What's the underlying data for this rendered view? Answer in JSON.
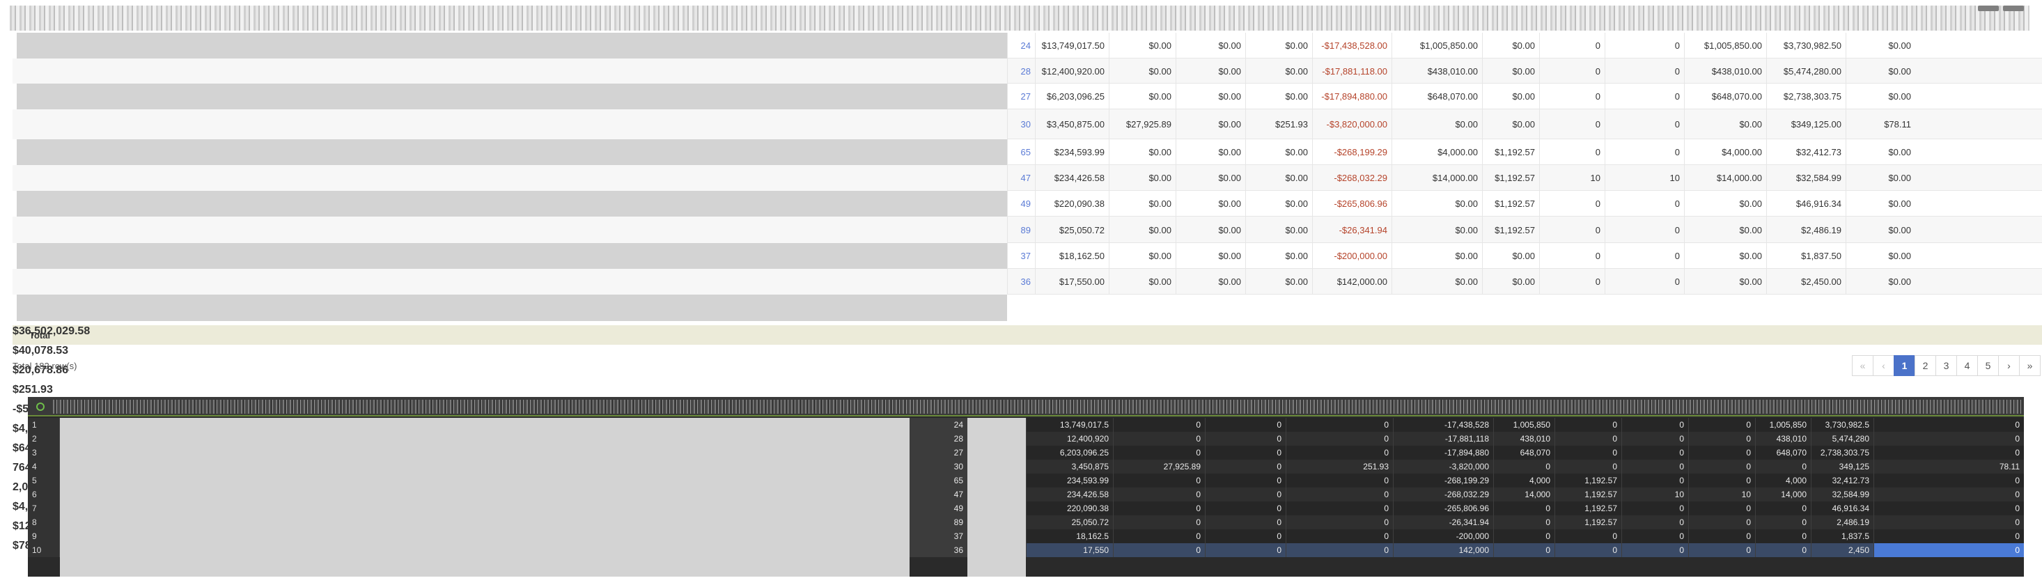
{
  "report": {
    "rows": [
      {
        "id": "24",
        "c1": "$13,749,017.50",
        "c2": "$0.00",
        "c3": "$0.00",
        "c4": "$0.00",
        "c5": "-$17,438,528.00",
        "c6": "$1,005,850.00",
        "c7": "$0.00",
        "c8": "0",
        "c9": "0",
        "c10": "$1,005,850.00",
        "c11": "$3,730,982.50",
        "c12": "$0.00"
      },
      {
        "id": "28",
        "c1": "$12,400,920.00",
        "c2": "$0.00",
        "c3": "$0.00",
        "c4": "$0.00",
        "c5": "-$17,881,118.00",
        "c6": "$438,010.00",
        "c7": "$0.00",
        "c8": "0",
        "c9": "0",
        "c10": "$438,010.00",
        "c11": "$5,474,280.00",
        "c12": "$0.00"
      },
      {
        "id": "27",
        "c1": "$6,203,096.25",
        "c2": "$0.00",
        "c3": "$0.00",
        "c4": "$0.00",
        "c5": "-$17,894,880.00",
        "c6": "$648,070.00",
        "c7": "$0.00",
        "c8": "0",
        "c9": "0",
        "c10": "$648,070.00",
        "c11": "$2,738,303.75",
        "c12": "$0.00"
      },
      {
        "id": "30",
        "c1": "$3,450,875.00",
        "c2": "$27,925.89",
        "c3": "$0.00",
        "c4": "$251.93",
        "c5": "-$3,820,000.00",
        "c6": "$0.00",
        "c7": "$0.00",
        "c8": "0",
        "c9": "0",
        "c10": "$0.00",
        "c11": "$349,125.00",
        "c12": "$78.11"
      },
      {
        "id": "65",
        "c1": "$234,593.99",
        "c2": "$0.00",
        "c3": "$0.00",
        "c4": "$0.00",
        "c5": "-$268,199.29",
        "c6": "$4,000.00",
        "c7": "$1,192.57",
        "c8": "0",
        "c9": "0",
        "c10": "$4,000.00",
        "c11": "$32,412.73",
        "c12": "$0.00"
      },
      {
        "id": "47",
        "c1": "$234,426.58",
        "c2": "$0.00",
        "c3": "$0.00",
        "c4": "$0.00",
        "c5": "-$268,032.29",
        "c6": "$14,000.00",
        "c7": "$1,192.57",
        "c8": "10",
        "c9": "10",
        "c10": "$14,000.00",
        "c11": "$32,584.99",
        "c12": "$0.00"
      },
      {
        "id": "49",
        "c1": "$220,090.38",
        "c2": "$0.00",
        "c3": "$0.00",
        "c4": "$0.00",
        "c5": "-$265,806.96",
        "c6": "$0.00",
        "c7": "$1,192.57",
        "c8": "0",
        "c9": "0",
        "c10": "$0.00",
        "c11": "$46,916.34",
        "c12": "$0.00"
      },
      {
        "id": "89",
        "c1": "$25,050.72",
        "c2": "$0.00",
        "c3": "$0.00",
        "c4": "$0.00",
        "c5": "-$26,341.94",
        "c6": "$0.00",
        "c7": "$1,192.57",
        "c8": "0",
        "c9": "0",
        "c10": "$0.00",
        "c11": "$2,486.19",
        "c12": "$0.00"
      },
      {
        "id": "37",
        "c1": "$18,162.50",
        "c2": "$0.00",
        "c3": "$0.00",
        "c4": "$0.00",
        "c5": "-$200,000.00",
        "c6": "$0.00",
        "c7": "$0.00",
        "c8": "0",
        "c9": "0",
        "c10": "$0.00",
        "c11": "$1,837.50",
        "c12": "$0.00"
      },
      {
        "id": "36",
        "c1": "$17,550.00",
        "c2": "$0.00",
        "c3": "$0.00",
        "c4": "$0.00",
        "c5": "$142,000.00",
        "c6": "$0.00",
        "c7": "$0.00",
        "c8": "0",
        "c9": "0",
        "c10": "$0.00",
        "c11": "$2,450.00",
        "c12": "$0.00"
      }
    ],
    "total": {
      "label": "Total",
      "c1": "$36,502,029.58",
      "c2": "$40,078.53",
      "c3": "$20,678.86",
      "c4": "$251.93",
      "c5": "-$57,503,237.66",
      "c6": "$4,955,787.20",
      "c7": "$64,677.32",
      "c8": "764",
      "c9": "2,078",
      "c10": "$4,471,170.00",
      "c11": "$12,412,538.83",
      "c12": "$78.35"
    },
    "row_count_text": "Total 182 row(s)"
  },
  "pagination": {
    "first": "«",
    "prev": "‹",
    "pages": [
      "1",
      "2",
      "3",
      "4",
      "5"
    ],
    "active": "1",
    "next": "›",
    "last": "»"
  },
  "grid": {
    "rows": [
      {
        "n": "1",
        "id": "24",
        "c1": "13,749,017.5",
        "c2": "0",
        "c3": "0",
        "c4": "0",
        "c5": "-17,438,528",
        "c6": "1,005,850",
        "c7": "0",
        "c8": "0",
        "c9": "0",
        "c10": "1,005,850",
        "c11": "3,730,982.5",
        "c12": "0"
      },
      {
        "n": "2",
        "id": "28",
        "c1": "12,400,920",
        "c2": "0",
        "c3": "0",
        "c4": "0",
        "c5": "-17,881,118",
        "c6": "438,010",
        "c7": "0",
        "c8": "0",
        "c9": "0",
        "c10": "438,010",
        "c11": "5,474,280",
        "c12": "0"
      },
      {
        "n": "3",
        "id": "27",
        "c1": "6,203,096.25",
        "c2": "0",
        "c3": "0",
        "c4": "0",
        "c5": "-17,894,880",
        "c6": "648,070",
        "c7": "0",
        "c8": "0",
        "c9": "0",
        "c10": "648,070",
        "c11": "2,738,303.75",
        "c12": "0"
      },
      {
        "n": "4",
        "id": "30",
        "c1": "3,450,875",
        "c2": "27,925.89",
        "c3": "0",
        "c4": "251.93",
        "c5": "-3,820,000",
        "c6": "0",
        "c7": "0",
        "c8": "0",
        "c9": "0",
        "c10": "0",
        "c11": "349,125",
        "c12": "78.11"
      },
      {
        "n": "5",
        "id": "65",
        "c1": "234,593.99",
        "c2": "0",
        "c3": "0",
        "c4": "0",
        "c5": "-268,199.29",
        "c6": "4,000",
        "c7": "1,192.57",
        "c8": "0",
        "c9": "0",
        "c10": "4,000",
        "c11": "32,412.73",
        "c12": "0"
      },
      {
        "n": "6",
        "id": "47",
        "c1": "234,426.58",
        "c2": "0",
        "c3": "0",
        "c4": "0",
        "c5": "-268,032.29",
        "c6": "14,000",
        "c7": "1,192.57",
        "c8": "10",
        "c9": "10",
        "c10": "14,000",
        "c11": "32,584.99",
        "c12": "0"
      },
      {
        "n": "7",
        "id": "49",
        "c1": "220,090.38",
        "c2": "0",
        "c3": "0",
        "c4": "0",
        "c5": "-265,806.96",
        "c6": "0",
        "c7": "1,192.57",
        "c8": "0",
        "c9": "0",
        "c10": "0",
        "c11": "46,916.34",
        "c12": "0"
      },
      {
        "n": "8",
        "id": "89",
        "c1": "25,050.72",
        "c2": "0",
        "c3": "0",
        "c4": "0",
        "c5": "-26,341.94",
        "c6": "0",
        "c7": "1,192.57",
        "c8": "0",
        "c9": "0",
        "c10": "0",
        "c11": "2,486.19",
        "c12": "0"
      },
      {
        "n": "9",
        "id": "37",
        "c1": "18,162.5",
        "c2": "0",
        "c3": "0",
        "c4": "0",
        "c5": "-200,000",
        "c6": "0",
        "c7": "0",
        "c8": "0",
        "c9": "0",
        "c10": "0",
        "c11": "1,837.5",
        "c12": "0"
      },
      {
        "n": "10",
        "id": "36",
        "c1": "17,550",
        "c2": "0",
        "c3": "0",
        "c4": "0",
        "c5": "142,000",
        "c6": "0",
        "c7": "0",
        "c8": "0",
        "c9": "0",
        "c10": "0",
        "c11": "2,450",
        "c12": "0"
      }
    ]
  },
  "colors": {
    "accent": "#4b72c9",
    "negative": "#b5442b",
    "total_bg": "#ecebd9",
    "grid_bg": "#2a2a2a",
    "grid_selected": "#3a4a66",
    "grid_highlight": "#4a7ad6"
  }
}
